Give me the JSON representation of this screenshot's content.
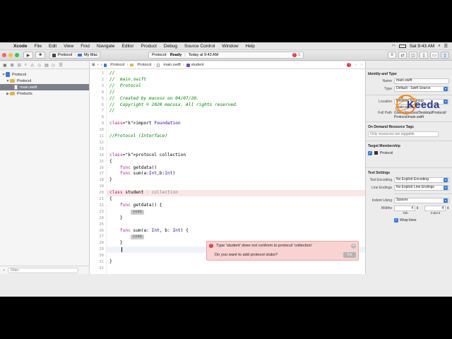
{
  "menubar": {
    "app": "Xcode",
    "items": [
      "File",
      "Edit",
      "View",
      "Find",
      "Navigate",
      "Editor",
      "Product",
      "Debug",
      "Source Control",
      "Window",
      "Help"
    ],
    "clock": "Sat 9:43 AM"
  },
  "toolbar": {
    "scheme": "Protocol",
    "destination": "My Mac",
    "status_project": "Protocol:",
    "status_state": "Ready",
    "status_time": "Today at 9:43 AM",
    "error_count": "1"
  },
  "navigator": {
    "items": [
      {
        "label": "Protocol",
        "level": 0,
        "kind": "project"
      },
      {
        "label": "Protocol",
        "level": 1,
        "kind": "folder"
      },
      {
        "label": "main.swift",
        "level": 2,
        "kind": "file",
        "selected": true
      },
      {
        "label": "Products",
        "level": 1,
        "kind": "folder"
      }
    ],
    "filter_placeholder": "Filter"
  },
  "jumpbar": {
    "crumbs": [
      "Protocol",
      "Protocol",
      "main.swift",
      "student"
    ]
  },
  "code": {
    "lines": [
      {
        "n": "1",
        "text": "//"
      },
      {
        "n": "2",
        "text": "//  main.swift"
      },
      {
        "n": "3",
        "text": "//  Protocol"
      },
      {
        "n": "4",
        "text": "//"
      },
      {
        "n": "5",
        "text": "//  Created by macosx on 04/07/20."
      },
      {
        "n": "6",
        "text": "//  Copyright © 2020 macosx. All rights reserved."
      },
      {
        "n": "7",
        "text": "//"
      },
      {
        "n": "8",
        "text": ""
      },
      {
        "n": "9",
        "text": "import Foundation"
      },
      {
        "n": "10",
        "text": ""
      },
      {
        "n": "11",
        "text": "//Protocol (Interface)"
      },
      {
        "n": "12",
        "text": ""
      },
      {
        "n": "13",
        "text": ""
      },
      {
        "n": "14",
        "text": "protocol collection"
      },
      {
        "n": "15",
        "text": "{"
      },
      {
        "n": "16",
        "text": "    func getdata()"
      },
      {
        "n": "17",
        "text": "    func sum(a:Int,b:Int)"
      },
      {
        "n": "18",
        "text": "}"
      },
      {
        "n": "19",
        "text": ""
      },
      {
        "n": "20",
        "text": "class student : collection"
      },
      {
        "n": "21",
        "text": "{"
      },
      {
        "n": "22",
        "text": "    func getdata() {"
      },
      {
        "n": "23",
        "text": "        code"
      },
      {
        "n": "24",
        "text": "    }"
      },
      {
        "n": "25",
        "text": ""
      },
      {
        "n": "26",
        "text": "    func sum(a: Int, b: Int) {"
      },
      {
        "n": "27",
        "text": "        code"
      },
      {
        "n": "28",
        "text": "    }"
      },
      {
        "n": "29",
        "text": ""
      },
      {
        "n": "30",
        "text": ""
      },
      {
        "n": "31",
        "text": "}"
      },
      {
        "n": "32",
        "text": ""
      }
    ],
    "placeholder": "code"
  },
  "error_popup": {
    "message": "Type 'student' does not conform to protocol 'collection'",
    "question": "Do you want to add protocol stubs?",
    "fix_label": "Fix"
  },
  "inspector": {
    "identity_heading": "Identity and Type",
    "name_label": "Name",
    "name_value": "main.swift",
    "type_label": "Type",
    "type_value": "Default - Swift Source",
    "location_label": "Location",
    "location_value": "Relative to Group",
    "location_file": "main.swift",
    "fullpath_label": "Full Path",
    "fullpath_value": "/Users/macosx/Desktop/Protocol/Protocol/main.swift",
    "odr_heading": "On Demand Resource Tags",
    "odr_placeholder": "Only resources are taggable",
    "target_heading": "Target Membership",
    "target_name": "Protocol",
    "text_heading": "Text Settings",
    "encoding_label": "Text Encoding",
    "encoding_value": "No Explicit Encoding",
    "endings_label": "Line Endings",
    "endings_value": "No Explicit Line Endings",
    "indent_label": "Indent Using",
    "indent_value": "Spaces",
    "widths_label": "Widths",
    "tab_value": "4",
    "indent_width_value": "4",
    "tab_label": "Tab",
    "indent_sub_label": "Indent",
    "wrap_label": "Wrap lines"
  },
  "logo": {
    "text": "Keeda"
  },
  "colors": {
    "comment": "#008400",
    "keyword": "#b21889",
    "error_bg": "#f8d3d2",
    "selection": "#7a7f89"
  }
}
